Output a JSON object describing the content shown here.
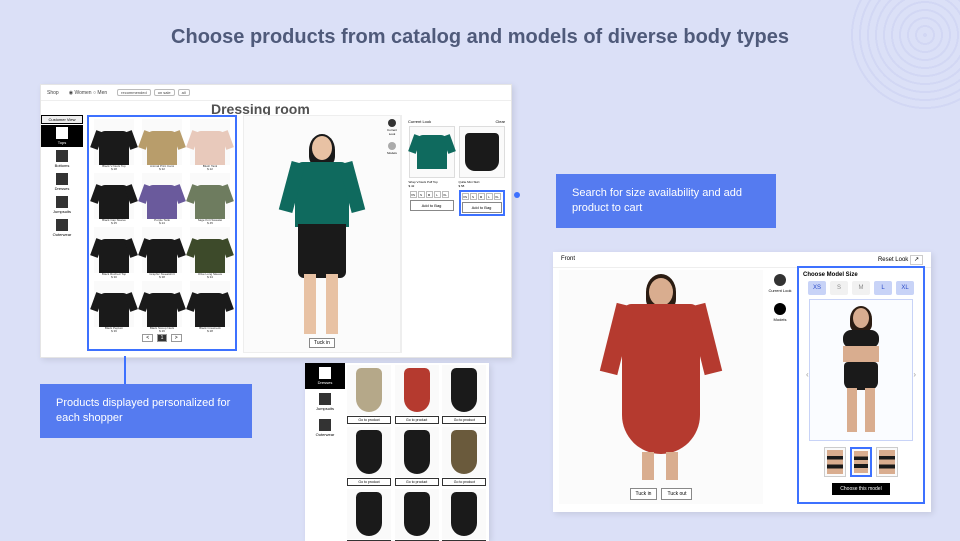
{
  "colors": {
    "accent": "#3d71ff",
    "callout": "#557bf0",
    "teal": "#0f6a5e",
    "red": "#b53a2f"
  },
  "title": "Choose products from catalog and models of diverse body types",
  "callouts": {
    "left": "Products displayed personalized for each shopper",
    "right": "Search for size availability and add product to cart"
  },
  "left_panel": {
    "header": {
      "app": "Shop",
      "nav": [
        "Women",
        "Men"
      ],
      "filters": [
        "recommended",
        "on sale",
        "all"
      ]
    },
    "title": "Dressing room",
    "categories": [
      {
        "label": "Customer View",
        "icon": "header"
      },
      {
        "label": "Tops",
        "icon": "top",
        "selected": true
      },
      {
        "label": "Bottoms",
        "icon": "bottom"
      },
      {
        "label": "Dresses",
        "icon": "dress"
      },
      {
        "label": "Jumpsuits",
        "icon": "jumpsuit"
      },
      {
        "label": "Outerwear",
        "icon": "outer"
      }
    ],
    "products": [
      {
        "name": "Black V-Neck Top",
        "price": "$ 28",
        "color": "#1a1a1a"
      },
      {
        "name": "Animal Print Cami",
        "price": "$ 32",
        "color": "#b89d6b"
      },
      {
        "name": "Blush Tank",
        "price": "$ 22",
        "color": "#e8c9bb"
      },
      {
        "name": "Black Cap Sleeve",
        "price": "$ 25",
        "color": "#1a1a1a"
      },
      {
        "name": "Purple Tank",
        "price": "$ 24",
        "color": "#6a5a9c"
      },
      {
        "name": "Sage Knit Sweater",
        "price": "$ 45",
        "color": "#6e7c5f"
      },
      {
        "name": "Black Ruched Top",
        "price": "$ 30",
        "color": "#1a1a1a"
      },
      {
        "name": "Graphic Sweatshirt",
        "price": "$ 38",
        "color": "#1a1a1a"
      },
      {
        "name": "Olive Long Sleeve",
        "price": "$ 34",
        "color": "#3d4a2a"
      },
      {
        "name": "Black Peplum",
        "price": "$ 36",
        "color": "#1a1a1a"
      },
      {
        "name": "Black Scoop Neck",
        "price": "$ 26",
        "color": "#1a1a1a"
      },
      {
        "name": "Black Crewneck",
        "price": "$ 28",
        "color": "#1a1a1a"
      }
    ],
    "pagination": {
      "prev": "<",
      "page": "1",
      "next": ">"
    },
    "tuck_btn": "Tuck in",
    "look": {
      "tabs": [
        {
          "label": "Current Look"
        },
        {
          "label": "Models"
        }
      ],
      "heading": "Current Look",
      "clear": "Clear",
      "items": [
        {
          "name": "Wrap V-Neck Puff Top",
          "price": "$ 42",
          "color": "#0f6a5e",
          "shape": "top",
          "sizes": [
            "XS",
            "S",
            "M",
            "L",
            "XL"
          ],
          "btn": "Add to Bag"
        },
        {
          "name": "Quilte Mini Skirt",
          "price": "$ 58",
          "color": "#1a1a1a",
          "shape": "skirt",
          "sizes": [
            "XS",
            "S",
            "M",
            "L",
            "XL"
          ],
          "btn": "Add to Bag",
          "highlight": true
        }
      ]
    },
    "model_outfit": {
      "top_color": "#0f6a5e",
      "bottom_color": "#1a1a1a"
    }
  },
  "mid_panel": {
    "categories": [
      {
        "label": "Dresses",
        "selected": true
      },
      {
        "label": "Jumpsuits"
      },
      {
        "label": "Outerwear"
      }
    ],
    "products": [
      {
        "color": "#b5a889",
        "btn": "Go to product"
      },
      {
        "color": "#b53a2f",
        "btn": "Go to product"
      },
      {
        "color": "#1a1a1a",
        "btn": "Go to product"
      },
      {
        "color": "#1a1a1a",
        "btn": "Go to product"
      },
      {
        "color": "#1a1a1a",
        "btn": "Go to product"
      },
      {
        "color": "#6a5a3c",
        "btn": "Go to product"
      },
      {
        "color": "#1a1a1a",
        "btn": "Go to product"
      },
      {
        "color": "#1a1a1a",
        "btn": "Go to product"
      },
      {
        "color": "#1a1a1a",
        "btn": "Go to product"
      }
    ]
  },
  "right_panel": {
    "header": {
      "front": "Front",
      "reset": "Reset Look",
      "export": "export-icon"
    },
    "tabs": [
      {
        "label": "Current Look"
      },
      {
        "label": "Models",
        "selected": true
      }
    ],
    "buttons": {
      "tuck_in": "Tuck in",
      "tuck_out": "Tuck out"
    },
    "size_panel": {
      "title": "Choose Model Size",
      "sizes": [
        {
          "v": "XS",
          "on": true
        },
        {
          "v": "S"
        },
        {
          "v": "M"
        },
        {
          "v": "L",
          "on": true
        },
        {
          "v": "XL",
          "on": true
        }
      ],
      "thumbs": [
        {
          "selected": false
        },
        {
          "selected": true
        },
        {
          "selected": false
        }
      ],
      "choose": "Choose this model"
    },
    "dress_color": "#b53a2f"
  }
}
